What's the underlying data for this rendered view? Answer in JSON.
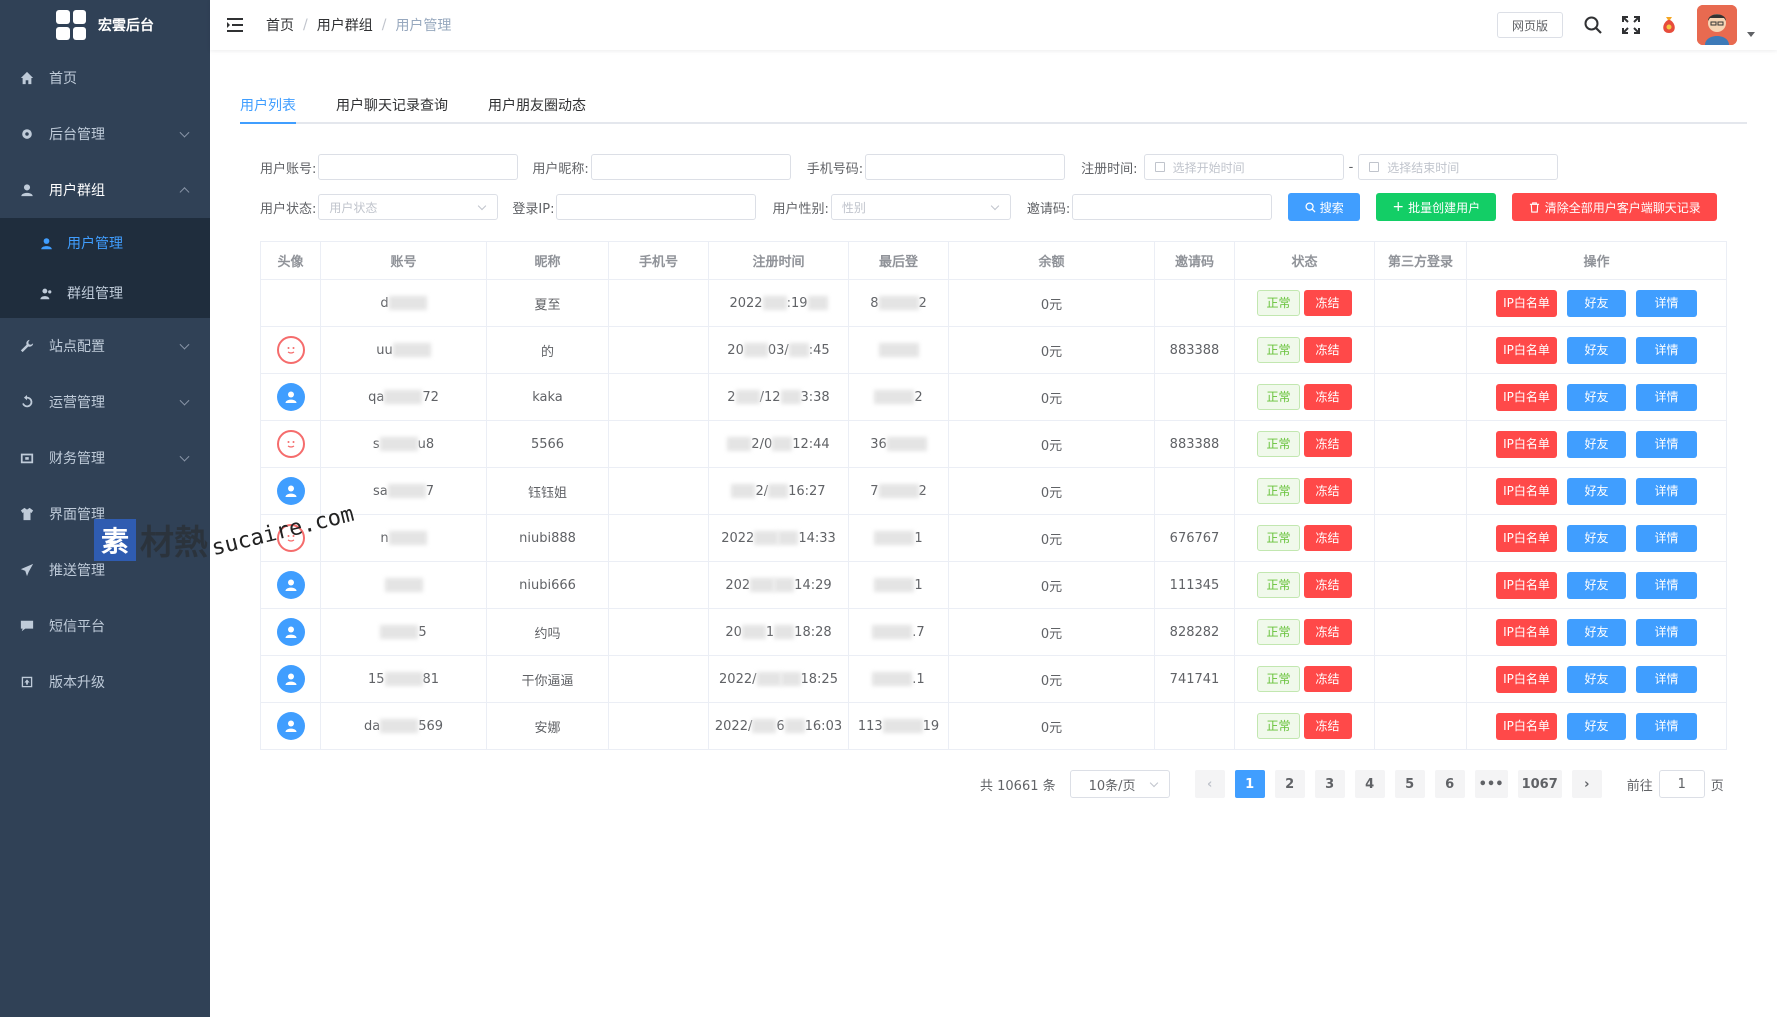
{
  "app": {
    "title": "宏雲后台"
  },
  "sidebar": {
    "items": [
      {
        "label": "首页",
        "icon": "home-icon"
      },
      {
        "label": "后台管理",
        "icon": "gear-icon"
      },
      {
        "label": "用户群组",
        "icon": "user-icon"
      },
      {
        "label": "站点配置",
        "icon": "wrench-icon"
      },
      {
        "label": "运营管理",
        "icon": "recycle-icon"
      },
      {
        "label": "财务管理",
        "icon": "wallet-icon"
      },
      {
        "label": "界面管理",
        "icon": "shirt-icon"
      },
      {
        "label": "推送管理",
        "icon": "send-icon"
      },
      {
        "label": "短信平台",
        "icon": "message-icon"
      },
      {
        "label": "版本升级",
        "icon": "upgrade-icon"
      }
    ],
    "sub": [
      {
        "label": "用户管理"
      },
      {
        "label": "群组管理"
      }
    ]
  },
  "header": {
    "breadcrumb": [
      "首页",
      "用户群组",
      "用户管理"
    ],
    "web_label": "网页版"
  },
  "tabs": [
    "用户列表",
    "用户聊天记录查询",
    "用户朋友圈动态"
  ],
  "filter": {
    "account_label": "用户账号:",
    "nickname_label": "用户昵称:",
    "phone_label": "手机号码:",
    "regtime_label": "注册时间:",
    "start_placeholder": "选择开始时间",
    "range_sep": "-",
    "end_placeholder": "选择结束时间",
    "status_label": "用户状态:",
    "status_placeholder": "用户状态",
    "ip_label": "登录IP:",
    "gender_label": "用户性别:",
    "gender_placeholder": "性别",
    "invite_label": "邀请码:",
    "search_btn": "搜索",
    "batch_btn": "批量创建用户",
    "clear_btn": "清除全部用户客户端聊天记录"
  },
  "table": {
    "columns": [
      "头像",
      "账号",
      "昵称",
      "手机号",
      "注册时间",
      "最后登",
      "余额",
      "邀请码",
      "状态",
      "第三方登录",
      "操作"
    ],
    "status_normal": "正常",
    "status_freeze": "冻结",
    "op_ip": "IP白名单",
    "op_friend": "好友",
    "op_detail": "详情",
    "rows": [
      {
        "avatar": "none",
        "acc_a": "d",
        "acc_b": "",
        "nick": "夏至",
        "reg_a": "2022",
        "reg_b": ":19",
        "last_a": "8",
        "last_b": "2",
        "balance": "0元",
        "invite": ""
      },
      {
        "avatar": "smile",
        "acc_a": "uu",
        "acc_b": "",
        "nick": "的",
        "reg_a": "20",
        "reg_b": "03/",
        "reg_c": ":45",
        "last_a": "",
        "last_b": "",
        "balance": "0元",
        "invite": "883388"
      },
      {
        "avatar": "blue",
        "acc_a": "qa",
        "acc_b": "72",
        "nick": "kaka",
        "reg_a": "2",
        "reg_b": "/12",
        "reg_c": "3:38",
        "last_a": "",
        "last_b": "2",
        "balance": "0元",
        "invite": ""
      },
      {
        "avatar": "smile",
        "acc_a": "s",
        "acc_b": "u8",
        "nick": "5566",
        "reg_a": "",
        "reg_b": "2/0",
        "reg_c": "12:44",
        "last_a": "36",
        "last_b": "",
        "balance": "0元",
        "invite": "883388"
      },
      {
        "avatar": "blue",
        "acc_a": "sa",
        "acc_b": "7",
        "nick": "钰钰姐",
        "reg_a": "",
        "reg_b": "2/",
        "reg_c": "16:27",
        "last_a": "7",
        "last_b": "2",
        "balance": "0元",
        "invite": ""
      },
      {
        "avatar": "smile",
        "acc_a": "n",
        "acc_b": "",
        "nick": "niubi888",
        "reg_a": "2022",
        "reg_b": "",
        "reg_c": "14:33",
        "last_a": "",
        "last_b": "1",
        "balance": "0元",
        "invite": "676767"
      },
      {
        "avatar": "blue",
        "acc_a": "",
        "acc_b": "",
        "nick": "niubi666",
        "reg_a": "202",
        "reg_b": "",
        "reg_c": "14:29",
        "last_a": "",
        "last_b": "1",
        "balance": "0元",
        "invite": "111345"
      },
      {
        "avatar": "blue",
        "acc_a": "",
        "acc_b": "5",
        "nick": "约吗",
        "reg_a": "20",
        "reg_b": "1",
        "reg_c": "18:28",
        "last_a": "",
        "last_b": ".7",
        "balance": "0元",
        "invite": "828282"
      },
      {
        "avatar": "blue",
        "acc_a": "15",
        "acc_b": "81",
        "nick": "干你逼逼",
        "reg_a": "2022/",
        "reg_b": "",
        "reg_c": "18:25",
        "last_a": "",
        "last_b": ".1",
        "balance": "0元",
        "invite": "741741"
      },
      {
        "avatar": "blue",
        "acc_a": "da",
        "acc_b": "569",
        "nick": "安娜",
        "reg_a": "2022/",
        "reg_b": "6",
        "reg_c": "16:03",
        "last_a": "113",
        "last_b": "19",
        "last_c": "3",
        "balance": "0元",
        "invite": ""
      }
    ]
  },
  "pagination": {
    "total": "共 10661 条",
    "page_size": "10条/页",
    "pages": [
      "1",
      "2",
      "3",
      "4",
      "5",
      "6",
      "•••",
      "1067"
    ],
    "goto_label": "前往",
    "goto_value": "1",
    "page_unit": "页"
  },
  "watermark": {
    "cn_box": "素",
    "cn": "材熱",
    "en": "sucaire.com"
  },
  "colors": {
    "sidebar_bg": "#304156",
    "primary": "#409eff",
    "danger": "#ff4949",
    "success": "#13ce66"
  }
}
